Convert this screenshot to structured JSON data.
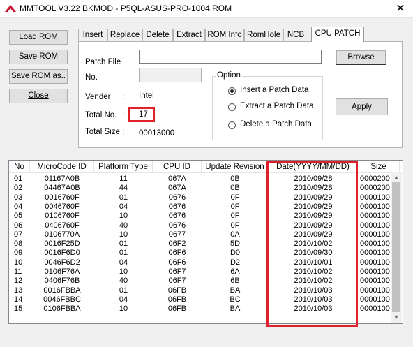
{
  "window": {
    "title": "MMTOOL V3.22 BKMOD - P5QL-ASUS-PRO-1004.ROM"
  },
  "sidebar": {
    "load_rom": "Load ROM",
    "save_rom": "Save ROM",
    "save_rom_as": "Save ROM as..",
    "close": "Close"
  },
  "tabs": [
    "Insert",
    "Replace",
    "Delete",
    "Extract",
    "ROM Info",
    "RomHole",
    "NCB",
    "CPU PATCH"
  ],
  "active_tab": "CPU PATCH",
  "patch": {
    "patch_file_label": "Patch File",
    "patch_file_value": "",
    "no_label": "No.",
    "no_value": "",
    "vender_label": "Vender",
    "vender_sep": ":",
    "vender_value": "Intel",
    "total_no_label": "Total No.",
    "total_no_sep": ":",
    "total_no_value": "17",
    "total_size_label": "Total Size",
    "total_size_sep": ":",
    "total_size_value": "00013000",
    "browse_label": "Browse",
    "apply_label": "Apply",
    "option_title": "Option",
    "options": [
      {
        "label": "Insert a Patch Data",
        "checked": true
      },
      {
        "label": "Extract a Patch Data",
        "checked": false
      },
      {
        "label": "Delete a Patch Data",
        "checked": false
      }
    ]
  },
  "table": {
    "columns": [
      "No",
      "MicroCode ID",
      "Platform Type",
      "CPU ID",
      "Update Revision",
      "Date(YYYY/MM/DD)",
      "Size"
    ],
    "rows": [
      [
        "01",
        "01167A0B",
        "11",
        "067A",
        "0B",
        "2010/09/28",
        "0000200"
      ],
      [
        "02",
        "04467A0B",
        "44",
        "067A",
        "0B",
        "2010/09/28",
        "0000200"
      ],
      [
        "03",
        "0016760F",
        "01",
        "0676",
        "0F",
        "2010/09/29",
        "0000100"
      ],
      [
        "04",
        "0046760F",
        "04",
        "0676",
        "0F",
        "2010/09/29",
        "0000100"
      ],
      [
        "05",
        "0106760F",
        "10",
        "0676",
        "0F",
        "2010/09/29",
        "0000100"
      ],
      [
        "06",
        "0406760F",
        "40",
        "0676",
        "0F",
        "2010/09/29",
        "0000100"
      ],
      [
        "07",
        "0106770A",
        "10",
        "0677",
        "0A",
        "2010/09/29",
        "0000100"
      ],
      [
        "08",
        "0016F25D",
        "01",
        "06F2",
        "5D",
        "2010/10/02",
        "0000100"
      ],
      [
        "09",
        "0016F6D0",
        "01",
        "06F6",
        "D0",
        "2010/09/30",
        "0000100"
      ],
      [
        "10",
        "0046F6D2",
        "04",
        "06F6",
        "D2",
        "2010/10/01",
        "0000100"
      ],
      [
        "11",
        "0106F76A",
        "10",
        "06F7",
        "6A",
        "2010/10/02",
        "0000100"
      ],
      [
        "12",
        "0406F76B",
        "40",
        "06F7",
        "6B",
        "2010/10/02",
        "0000100"
      ],
      [
        "13",
        "0016FBBA",
        "01",
        "06FB",
        "BA",
        "2010/10/03",
        "0000100"
      ],
      [
        "14",
        "0046FBBC",
        "04",
        "06FB",
        "BC",
        "2010/10/03",
        "0000100"
      ],
      [
        "15",
        "0106FBBA",
        "10",
        "06FB",
        "BA",
        "2010/10/03",
        "0000100"
      ]
    ]
  },
  "colors": {
    "highlight": "#e0202a",
    "icon_red": "#c8102e"
  }
}
